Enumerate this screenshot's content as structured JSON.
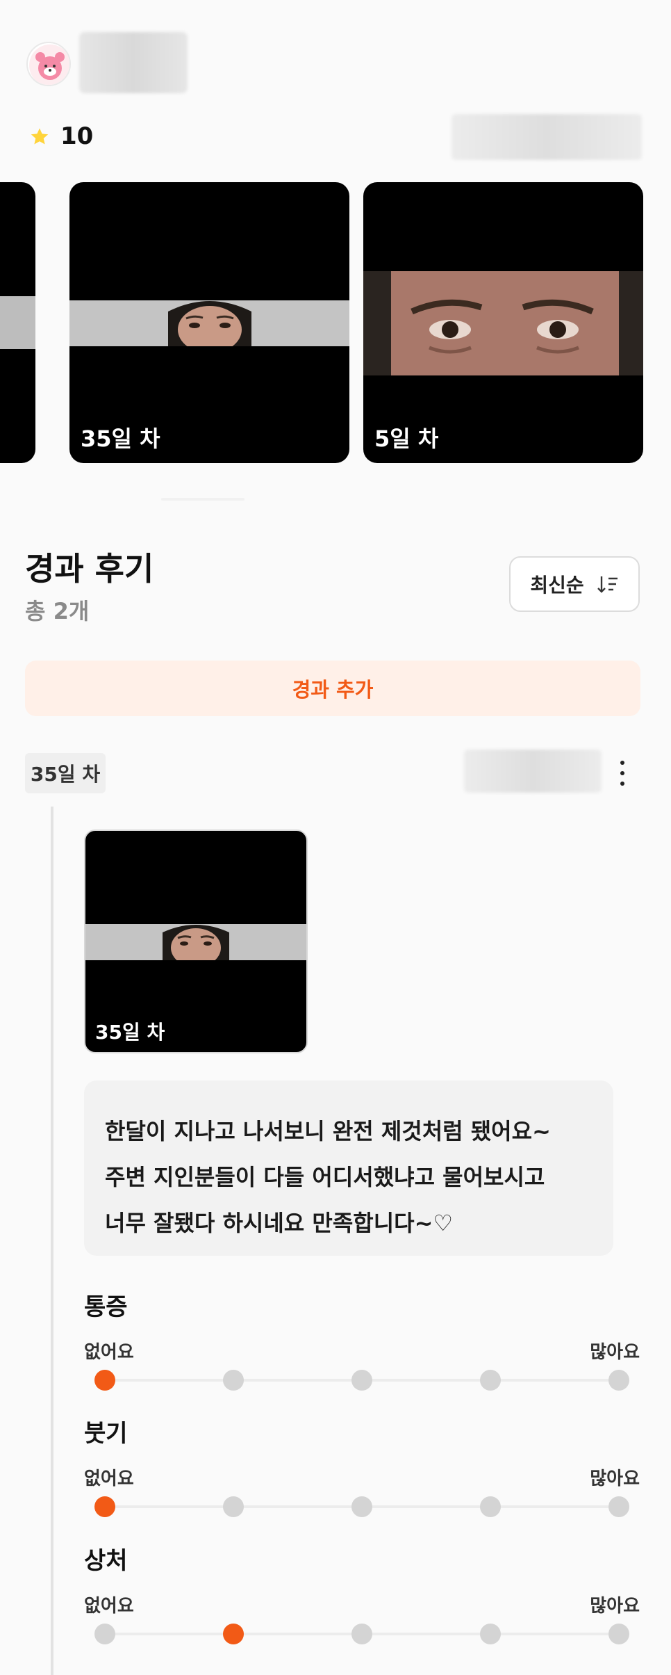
{
  "profile": {
    "avatar_icon": "bear-avatar-icon"
  },
  "rating": {
    "value": "10",
    "star_color": "#ffd43b"
  },
  "carousel": {
    "cards": [
      {
        "label": ""
      },
      {
        "label": "35일 차"
      },
      {
        "label": "5일 차"
      }
    ]
  },
  "reviews": {
    "title": "경과 후기",
    "count": "총 2개",
    "sort_label": "최신순",
    "add_label": "경과 추가",
    "accent": "#f25a16"
  },
  "entry": {
    "day_tag": "35일 차",
    "thumb_label": "35일 차",
    "text_lines": [
      "한달이 지나고 나서보니 완전 제것처럼 됐어요~",
      "주변 지인분들이 다들 어디서했냐고 물어보시고",
      "너무 잘됐다 하시네요 만족합니다~♡"
    ],
    "metrics": [
      {
        "title": "통증",
        "min_label": "없어요",
        "max_label": "많아요",
        "level": 1,
        "scale": 5
      },
      {
        "title": "붓기",
        "min_label": "없어요",
        "max_label": "많아요",
        "level": 1,
        "scale": 5
      },
      {
        "title": "상처",
        "min_label": "없어요",
        "max_label": "많아요",
        "level": 2,
        "scale": 5
      }
    ]
  }
}
